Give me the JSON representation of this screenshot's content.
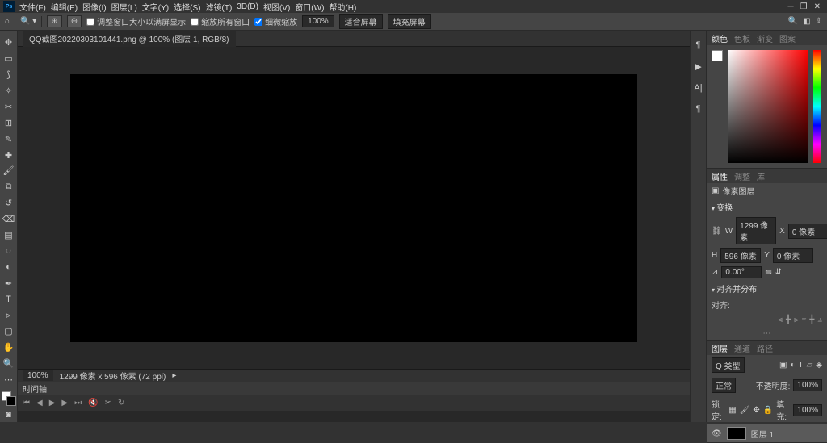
{
  "menubar": {
    "items": [
      "文件(F)",
      "编辑(E)",
      "图像(I)",
      "图层(L)",
      "文字(Y)",
      "选择(S)",
      "滤镜(T)",
      "3D(D)",
      "视图(V)",
      "窗口(W)",
      "帮助(H)"
    ]
  },
  "optbar": {
    "resize_window": "调整窗口大小以满屏显示",
    "zoom_all": "缩放所有窗口",
    "scrubby": "细微缩放",
    "zoom_value": "100%",
    "fit_screen": "适合屏幕",
    "fill_screen": "填充屏幕"
  },
  "doc": {
    "tab": "QQ截图20220303101441.png @ 100% (图层 1, RGB/8)"
  },
  "status": {
    "zoom": "100%",
    "dims": "1299 像素 x 596 像素 (72 ppi)"
  },
  "timeline": {
    "label": "时间轴"
  },
  "panels": {
    "color": {
      "tabs": [
        "颜色",
        "色板",
        "渐变",
        "图案"
      ]
    },
    "properties": {
      "tabs": [
        "属性",
        "调整",
        "库"
      ],
      "pixel_layer": "像素图层",
      "transform_hdr": "变换",
      "w_label": "W",
      "w_val": "1299 像素",
      "x_label": "X",
      "x_val": "0 像素",
      "h_label": "H",
      "h_val": "596 像素",
      "y_label": "Y",
      "y_val": "0 像素",
      "angle": "0.00°",
      "align_hdr": "对齐并分布",
      "align_label": "对齐:"
    },
    "layers": {
      "tabs": [
        "图层",
        "通道",
        "路径"
      ],
      "type": "Q 类型",
      "blend": "正常",
      "opacity_label": "不透明度:",
      "opacity_val": "100%",
      "lock_label": "锁定:",
      "fill_label": "填充:",
      "fill_val": "100%",
      "layer_name": "图层 1"
    }
  }
}
